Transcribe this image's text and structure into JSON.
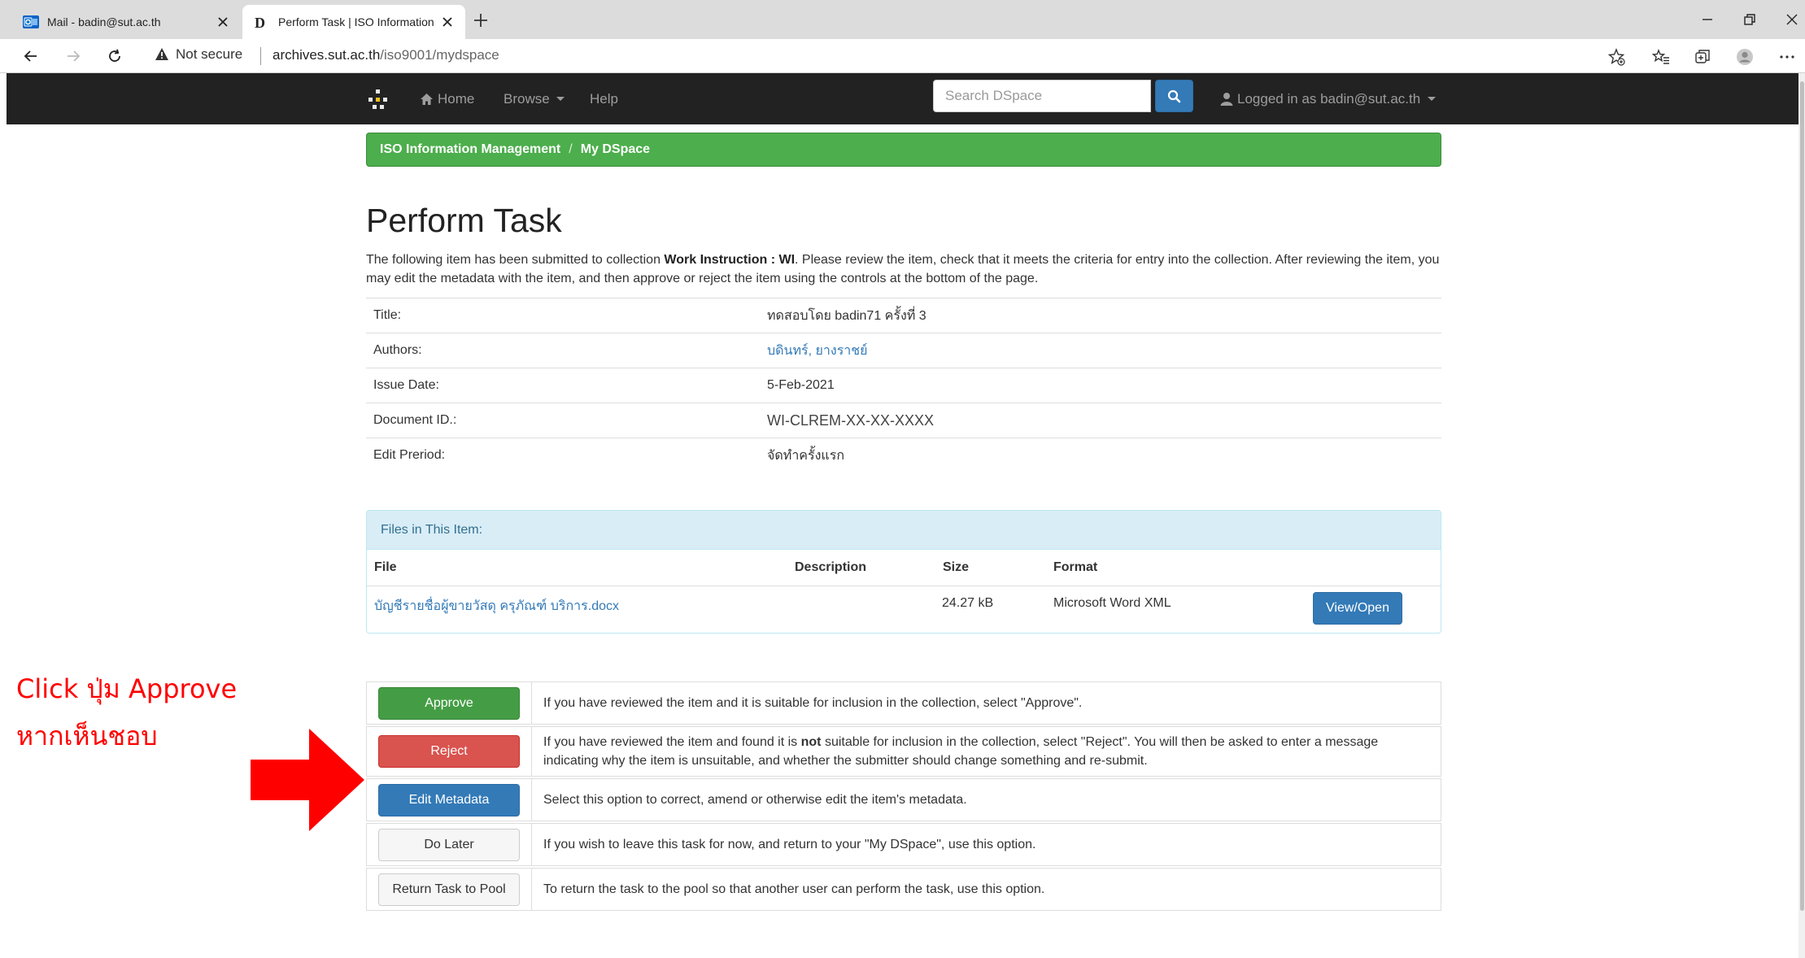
{
  "browser": {
    "tabs": [
      {
        "label": "Mail - badin@sut.ac.th",
        "active": false,
        "icon": "outlook-icon"
      },
      {
        "label": "Perform Task | ISO Information Management",
        "active": true,
        "icon": "dspace-icon"
      }
    ],
    "security_label": "Not secure",
    "url_host": "archives.sut.ac.th",
    "url_path": "/iso9001/mydspace"
  },
  "navbar": {
    "home_label": "Home",
    "browse_label": "Browse",
    "help_label": "Help",
    "search_placeholder": "Search DSpace",
    "user_label": "Logged in as badin@sut.ac.th"
  },
  "breadcrumb": {
    "items": [
      "ISO Information Management",
      "My DSpace"
    ]
  },
  "page": {
    "title": "Perform Task",
    "intro_before": "The following item has been submitted to collection ",
    "intro_collection": "Work Instruction : WI",
    "intro_after": ". Please review the item, check that it meets the criteria for entry into the collection. After reviewing the item, you may edit the metadata with the item, and then approve or reject the item using the controls at the bottom of the page."
  },
  "metadata": [
    {
      "label": "Title:",
      "value": "ทดสอบโดย badin71 ครั้งที่ 3"
    },
    {
      "label": "Authors:",
      "value": "บดินทร์, ยางราชย์"
    },
    {
      "label": "Issue Date:",
      "value": "5-Feb-2021"
    },
    {
      "label": "Document ID.:",
      "value": "WI-CLREM-XX-XX-XXXX"
    },
    {
      "label": "Edit Preriod:",
      "value": "จัดทำครั้งแรก"
    }
  ],
  "files": {
    "panel_title": "Files in This Item:",
    "headers": {
      "file": "File",
      "description": "Description",
      "size": "Size",
      "format": "Format"
    },
    "rows": [
      {
        "file": "บัญชีรายชื่อผู้ขายวัสดุ ครุภัณฑ์ บริการ.docx",
        "description": "",
        "size": "24.27 kB",
        "format": "Microsoft Word XML",
        "button": "View/Open"
      }
    ]
  },
  "actions": {
    "approve": {
      "label": "Approve",
      "desc": "If you have reviewed the item and it is suitable for inclusion in the collection, select \"Approve\"."
    },
    "reject": {
      "label": "Reject",
      "desc_before": "If you have reviewed the item and found it is ",
      "desc_bold": "not",
      "desc_after": " suitable for inclusion in the collection, select \"Reject\". You will then be asked to enter a message indicating why the item is unsuitable, and whether the submitter should change something and re-submit."
    },
    "edit": {
      "label": "Edit Metadata",
      "desc": "Select this option to correct, amend or otherwise edit the item's metadata."
    },
    "later": {
      "label": "Do Later",
      "desc": "If you wish to leave this task for now, and return to your \"My DSpace\", use this option."
    },
    "pool": {
      "label": "Return Task to Pool",
      "desc": "To return the task to the pool so that another user can perform the task, use this option."
    }
  },
  "annotation": {
    "line1": "Click ปุ่ม Approve",
    "line2": "หากเห็นชอบ",
    "color": "#ff0000"
  },
  "colors": {
    "navbar_bg": "#222222",
    "breadcrumb_bg": "#4cae4c",
    "primary": "#337ab7",
    "success": "#449d44",
    "danger": "#d9534f",
    "info_bg": "#d9edf7"
  }
}
